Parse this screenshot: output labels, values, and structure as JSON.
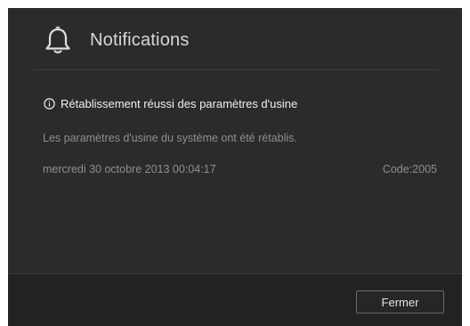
{
  "dialog": {
    "title": "Notifications",
    "title_icon": "bell-icon"
  },
  "notification": {
    "status_icon": "info-icon",
    "title": "Rétablissement réussi des paramètres d'usine",
    "body": "Les paramètres d'usine du système ont été rétablis.",
    "date": "mercredi 30 octobre 2013 00:04:17",
    "code": "Code:2005"
  },
  "footer": {
    "close_label": "Fermer"
  },
  "colors": {
    "dialog_background": "#2b2b2b",
    "footer_background": "#222222",
    "title_text": "#d8d8d8",
    "secondary_text": "#8f8f8f"
  }
}
